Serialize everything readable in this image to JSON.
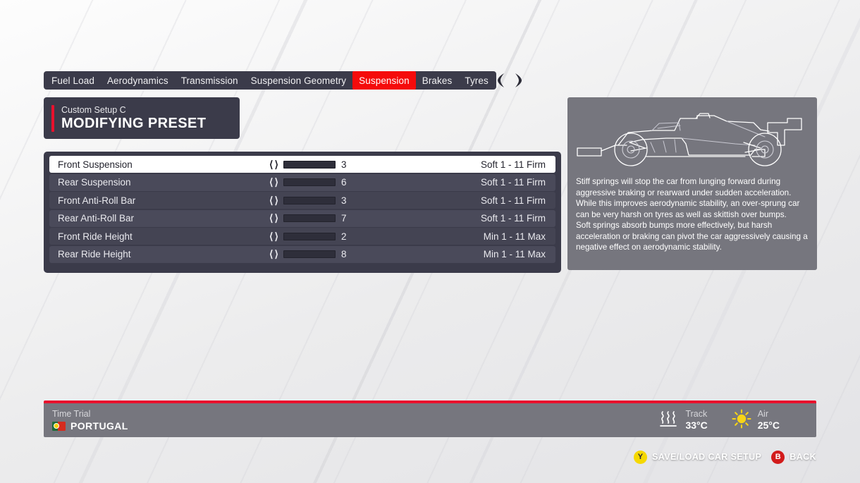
{
  "tabs": [
    {
      "label": "Fuel Load",
      "active": false
    },
    {
      "label": "Aerodynamics",
      "active": false
    },
    {
      "label": "Transmission",
      "active": false
    },
    {
      "label": "Suspension Geometry",
      "active": false
    },
    {
      "label": "Suspension",
      "active": true
    },
    {
      "label": "Brakes",
      "active": false
    },
    {
      "label": "Tyres",
      "active": false
    }
  ],
  "header": {
    "subtitle": "Custom Setup  C",
    "title": "MODIFYING PRESET"
  },
  "settings": {
    "rows": [
      {
        "label": "Front Suspension",
        "value": "3",
        "max": 11,
        "scale": "Soft 1 - 11 Firm",
        "selected": true
      },
      {
        "label": "Rear Suspension",
        "value": "6",
        "max": 11,
        "scale": "Soft 1 - 11 Firm",
        "selected": false
      },
      {
        "label": "Front Anti-Roll Bar",
        "value": "3",
        "max": 11,
        "scale": "Soft 1 - 11 Firm",
        "selected": false
      },
      {
        "label": "Rear Anti-Roll Bar",
        "value": "7",
        "max": 11,
        "scale": "Soft 1 - 11 Firm",
        "selected": false
      },
      {
        "label": "Front Ride Height",
        "value": "2",
        "max": 11,
        "scale": "Min 1 - 11 Max",
        "selected": false
      },
      {
        "label": "Rear Ride Height",
        "value": "8",
        "max": 11,
        "scale": "Min 1 - 11 Max",
        "selected": false
      }
    ]
  },
  "info": {
    "description": [
      "Stiff springs will stop the car from lunging forward during aggressive braking or rearward under sudden acceleration. While this improves aerodynamic stability, an over-sprung car can be very harsh on tyres as well as skittish over bumps.",
      "Soft springs absorb bumps more effectively, but harsh acceleration or braking can pivot the car aggressively causing a negative effect on aerodynamic stability."
    ]
  },
  "status": {
    "mode": "Time Trial",
    "country": "PORTUGAL",
    "track_label": "Track",
    "track_temp": "33°C",
    "air_label": "Air",
    "air_temp": "25°C"
  },
  "prompts": [
    {
      "button": "Y",
      "label": "SAVE/LOAD CAR SETUP"
    },
    {
      "button": "B",
      "label": "BACK"
    }
  ],
  "colors": {
    "accent_red": "#e8112d",
    "tab_active": "#f50b0b",
    "panel_dark": "#3b3b4a",
    "panel_gray": "#76767e",
    "button_y": "#f5d800",
    "button_b": "#d21b1b"
  }
}
